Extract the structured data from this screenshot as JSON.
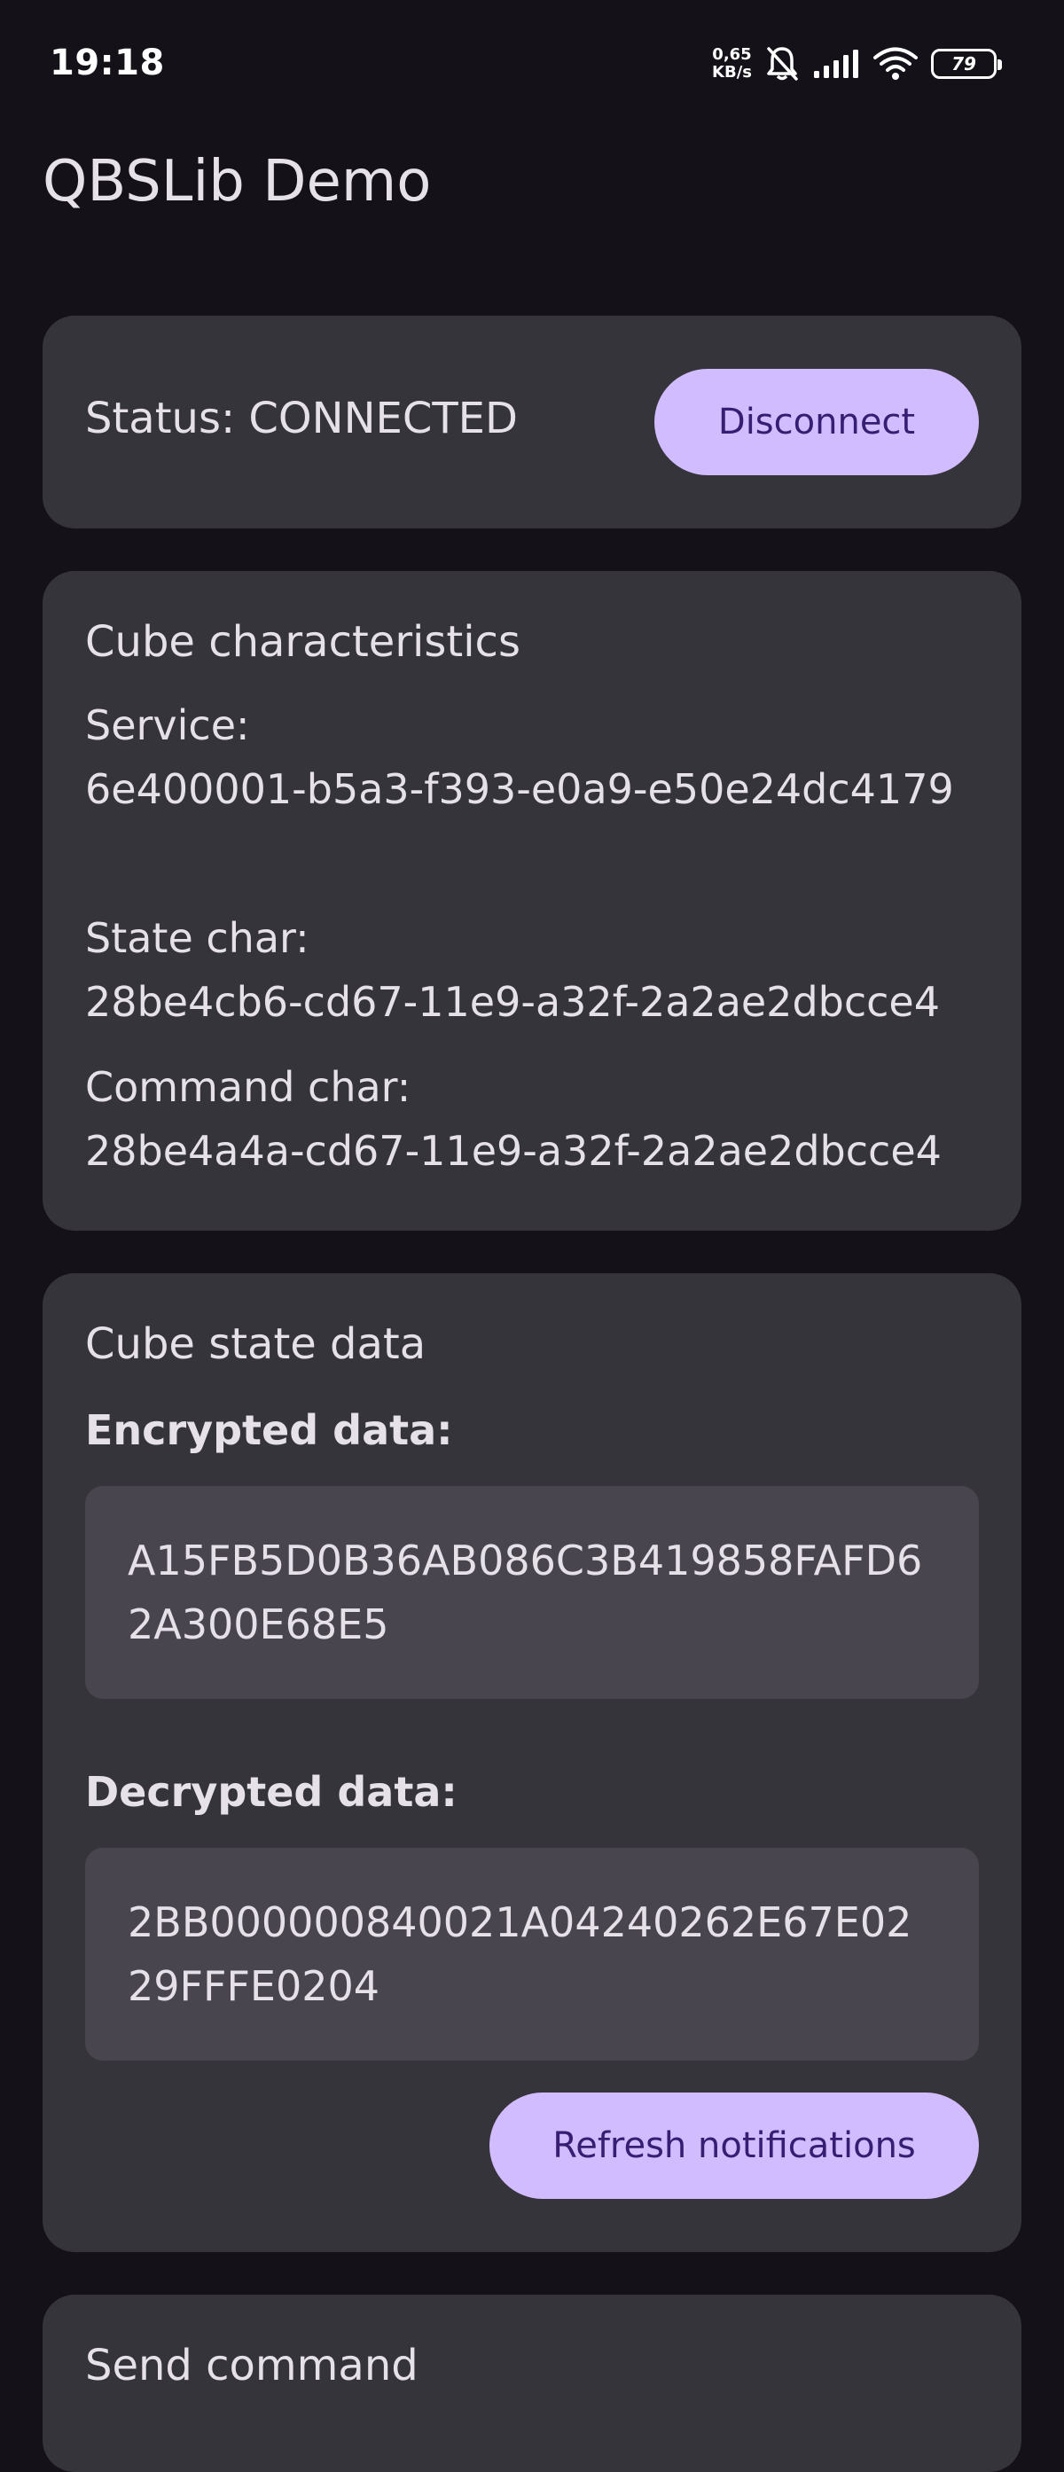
{
  "status_bar": {
    "time": "19:18",
    "net_speed_value": "0,65",
    "net_speed_unit": "KB/s",
    "battery": "79",
    "icons": [
      "bell-off-icon",
      "signal-icon",
      "wifi-icon",
      "battery-icon"
    ]
  },
  "app": {
    "title": "QBSLib Demo"
  },
  "status_card": {
    "status_text": "Status: CONNECTED",
    "disconnect_label": "Disconnect"
  },
  "characteristics_card": {
    "heading": "Cube characteristics",
    "service_label": "Service:",
    "service_value": "6e400001-b5a3-f393-e0a9-e50e24dc4179",
    "state_label": "State char:",
    "state_value": "28be4cb6-cd67-11e9-a32f-2a2ae2dbcce4",
    "command_label": "Command char:",
    "command_value": "28be4a4a-cd67-11e9-a32f-2a2ae2dbcce4"
  },
  "state_card": {
    "heading": "Cube state data",
    "encrypted_label": "Encrypted data:",
    "encrypted_value": "A15FB5D0B36AB086C3B419858FAFD62A300E68E5",
    "decrypted_label": "Decrypted data:",
    "decrypted_value": "2BB000000840021A04240262E67E0229FFFE0204",
    "refresh_label": "Refresh notifications"
  },
  "send_card": {
    "heading": "Send command"
  },
  "colors": {
    "background": "#141218",
    "card": "#36343B",
    "data_box": "#49454F",
    "button": "#D0BCFF",
    "button_text": "#381E72",
    "text": "#E6E0E9"
  }
}
